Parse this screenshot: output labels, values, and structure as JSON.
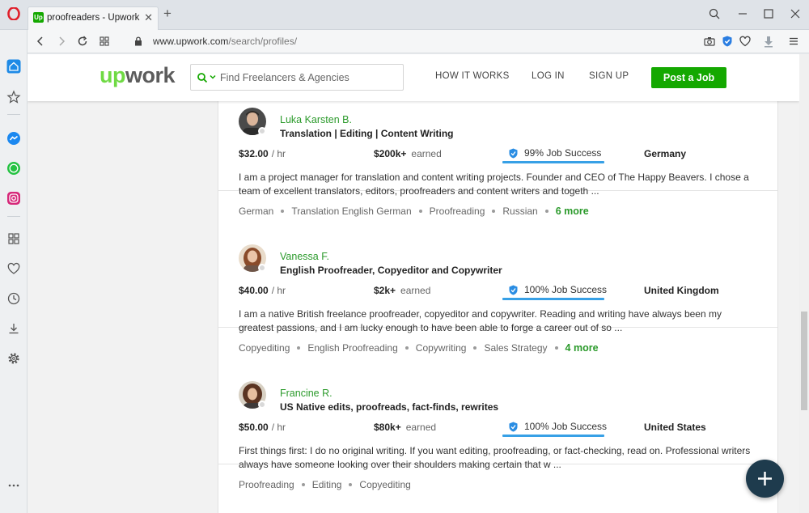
{
  "browser": {
    "tab_title": "proofreaders - Upwork",
    "favicon_text": "Up",
    "url_domain": "www.upwork.com",
    "url_path": "/search/profiles/"
  },
  "header": {
    "logo_up": "up",
    "logo_rest": "work",
    "search_placeholder": "Find Freelancers & Agencies",
    "nav": [
      "HOW IT WORKS",
      "LOG IN",
      "SIGN UP"
    ],
    "post_job": "Post a Job"
  },
  "colors": {
    "accent_green": "#14a800",
    "name_green": "#2b9a2b",
    "job_success_blue": "#37a0e6",
    "fab_navy": "#1e3b4d"
  },
  "freelancers": [
    {
      "name": "Luka Karsten B.",
      "title": "Translation | Editing | Content Writing",
      "rate": "$32.00",
      "rate_unit": "/ hr",
      "earned": "$200k+",
      "earned_label": "earned",
      "job_success": "99% Job Success",
      "country": "Germany",
      "description": "I am a project manager for translation and content writing projects. Founder and CEO of The Happy Beavers. I chose a team of excellent translators, editors, proofreaders and content writers and togeth ...",
      "skills": [
        "German",
        "Translation English German",
        "Proofreading",
        "Russian"
      ],
      "more": "6 more"
    },
    {
      "name": "Vanessa F.",
      "title": "English Proofreader, Copyeditor and Copywriter",
      "rate": "$40.00",
      "rate_unit": "/ hr",
      "earned": "$2k+",
      "earned_label": "earned",
      "job_success": "100% Job Success",
      "country": "United Kingdom",
      "description": "I am a native British freelance proofreader, copyeditor and copywriter. Reading and writing have always been my greatest passions, and I am lucky enough to have been able to forge a career out of so ...",
      "skills": [
        "Copyediting",
        "English Proofreading",
        "Copywriting",
        "Sales Strategy"
      ],
      "more": "4 more"
    },
    {
      "name": "Francine R.",
      "title": "US Native edits, proofreads, fact-finds, rewrites",
      "rate": "$50.00",
      "rate_unit": "/ hr",
      "earned": "$80k+",
      "earned_label": "earned",
      "job_success": "100% Job Success",
      "country": "United States",
      "description": "First things first: I do no original writing. If you want editing, proofreading, or fact-checking, read on. Professional writers always have someone looking over their shoulders making certain that w ...",
      "skills": [
        "Proofreading",
        "Editing",
        "Copyediting"
      ],
      "more": ""
    }
  ],
  "icons": {
    "sidebar": [
      "home-icon",
      "bookmarks-star-icon",
      "messenger-icon",
      "whatsapp-icon",
      "instagram-icon",
      "speed-dial-icon",
      "heart-icon",
      "history-clock-icon",
      "downloads-icon",
      "settings-gear-icon",
      "more-dots-icon"
    ],
    "addressbar": [
      "back-icon",
      "forward-icon",
      "reload-icon",
      "tabs-grid-icon",
      "lock-icon",
      "camera-icon",
      "adblock-shield-icon",
      "heart-icon",
      "download-icon",
      "menu-icon"
    ],
    "fab": "plus-icon"
  }
}
